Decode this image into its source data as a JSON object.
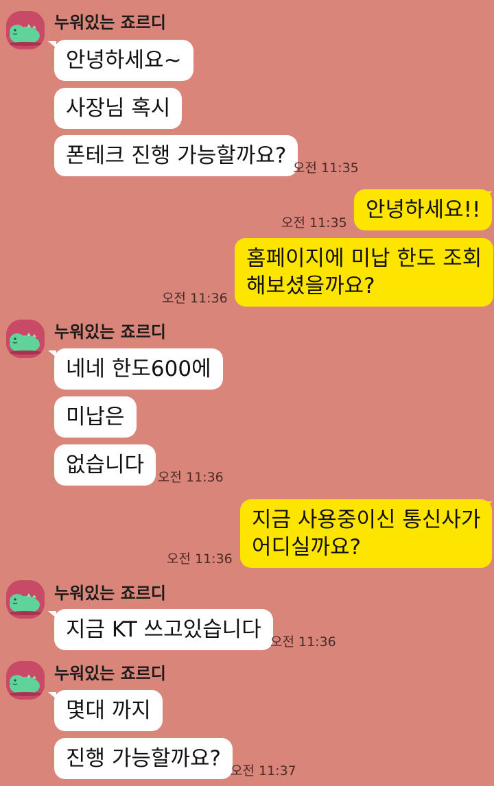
{
  "theme": {
    "background": "#d9857a",
    "incoming_bubble": "#ffffff",
    "outgoing_bubble": "#fee500",
    "avatar_bg": "#c84a66",
    "avatar_character": "#5fd39a"
  },
  "contact": {
    "name": "누워있는 죠르디",
    "avatar_icon": "jordy-dinosaur-avatar"
  },
  "messages": [
    {
      "dir": "in",
      "text": "안녕하세요~"
    },
    {
      "dir": "in",
      "text": "사장님 혹시"
    },
    {
      "dir": "in",
      "text": "폰테크 진행 가능할까요?",
      "time": "오전 11:35"
    },
    {
      "dir": "out",
      "text": "안녕하세요!!",
      "time": "오전 11:35"
    },
    {
      "dir": "out",
      "line1": "홈페이지에 미납 한도 조회",
      "line2": "해보셨을까요?",
      "time": "오전 11:36"
    },
    {
      "dir": "in",
      "text": "네네 한도600에"
    },
    {
      "dir": "in",
      "text": "미납은"
    },
    {
      "dir": "in",
      "text": "없습니다",
      "time": "오전 11:36"
    },
    {
      "dir": "out",
      "line1": "지금 사용중이신 통신사가",
      "line2": "어디실까요?",
      "time": "오전 11:36"
    },
    {
      "dir": "in",
      "text": "지금 KT 쓰고있습니다",
      "time": "오전 11:36"
    },
    {
      "dir": "in",
      "text": "몇대 까지"
    },
    {
      "dir": "in",
      "text": "진행 가능할까요?",
      "time": "오전 11:37"
    }
  ]
}
